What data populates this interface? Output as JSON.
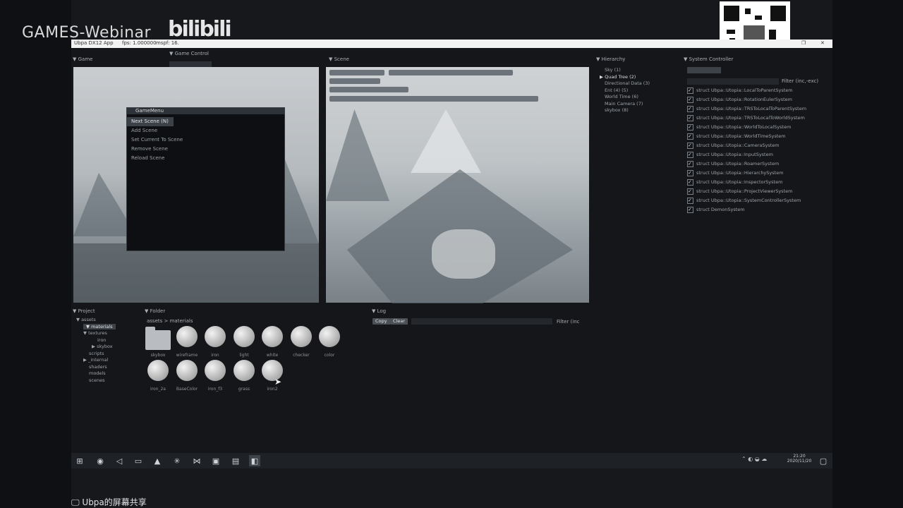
{
  "overlay": {
    "watermark": "GAMES-Webinar",
    "bili_logo": "bilibili",
    "share_label": "Ubpa的屏幕共享"
  },
  "window": {
    "title": "Ubpa DX12 App",
    "fps": "fps: 1.000000",
    "mspf": "mspf: 16.",
    "game_controls": "Game Control"
  },
  "panes": {
    "game": {
      "title": "Game"
    },
    "scene": {
      "title": "Scene"
    },
    "hierarchy": {
      "title": "Hierarchy",
      "items": [
        "Sky (1)",
        "Quad Tree (2)",
        "Directional Data (3)",
        "Ent (4) (5)",
        "World Time (6)",
        "Main Camera (7)",
        "skybox (8)"
      ]
    },
    "systems": {
      "title": "System Controller",
      "filter": "Filter (inc,-exc)",
      "items": [
        "struct Ubpa::Utopia::LocalToParentSystem",
        "struct Ubpa::Utopia::RotationEulerSystem",
        "struct Ubpa::Utopia::TRSToLocalToParentSystem",
        "struct Ubpa::Utopia::TRSToLocalToWorldSystem",
        "struct Ubpa::Utopia::WorldToLocalSystem",
        "struct Ubpa::Utopia::WorldTimeSystem",
        "struct Ubpa::Utopia::CameraSystem",
        "struct Ubpa::Utopia::InputSystem",
        "struct Ubpa::Utopia::RoamerSystem",
        "struct Ubpa::Utopia::HierarchySystem",
        "struct Ubpa::Utopia::InspectorSystem",
        "struct Ubpa::Utopia::ProjectViewerSystem",
        "struct Ubpa::Utopia::SystemControllerSystem",
        "struct DemonSystem"
      ]
    },
    "project": {
      "title": "Project",
      "tree": [
        "assets",
        "materials",
        "textures",
        "iron",
        "skybox",
        "scripts",
        "_internal",
        "shaders",
        "models",
        "scenes"
      ]
    },
    "folder": {
      "title": "Folder",
      "breadcrumb": "assets > materials",
      "assets_row1": [
        "skybox",
        "wireframe",
        "iron",
        "light",
        "white",
        "checker",
        "color"
      ],
      "assets_row2": [
        "iron_2a",
        "BaseColor",
        "iron_f3",
        "grass",
        "iron2"
      ]
    },
    "log": {
      "title": "Log",
      "clear_label": "Clear",
      "copy_label": "Copy",
      "filter": "Filter (inc"
    }
  },
  "game_menu": {
    "title": "GameMenu",
    "items": [
      "Next Scene (N)",
      "Add Scene",
      "Set Current To Scene",
      "Remove Scene",
      "Reload Scene"
    ]
  },
  "taskbar": {
    "time": "21:20",
    "date": "2020/11/20",
    "icons": [
      "windows-icon",
      "chrome-icon",
      "vs-icon",
      "folder-icon",
      "unity-icon",
      "settings-icon",
      "vscode-icon",
      "app-icon",
      "app2-icon",
      "ubpa-icon"
    ]
  }
}
